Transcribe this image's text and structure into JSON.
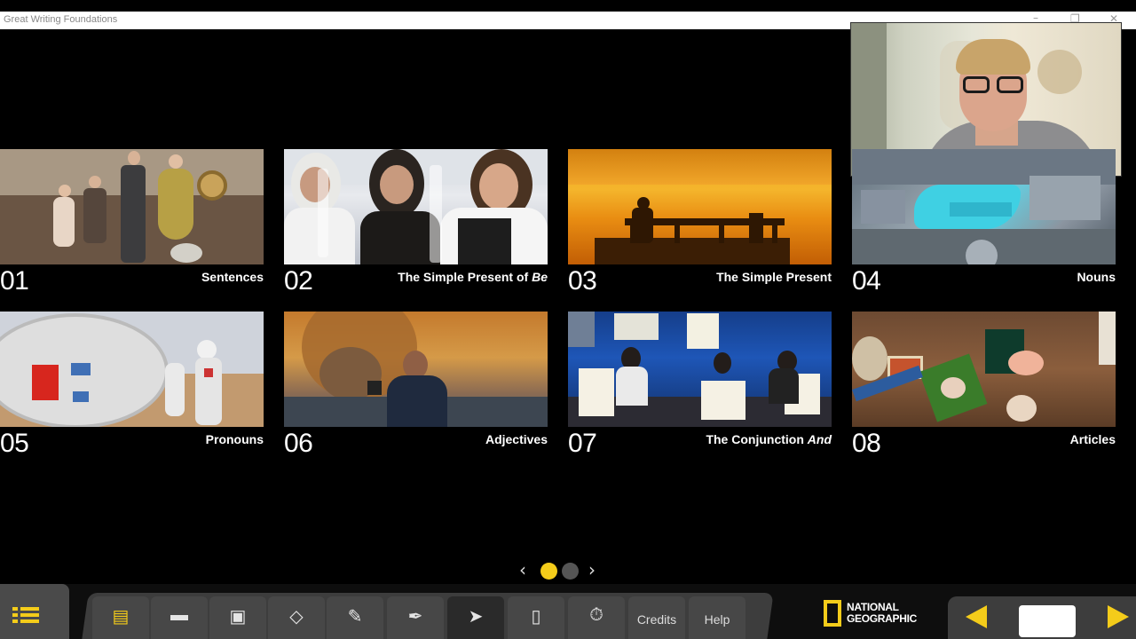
{
  "window": {
    "title": "Great Writing Foundations",
    "controls": {
      "minimize": "–",
      "maximize": "❐",
      "close": "✕"
    }
  },
  "cards": [
    {
      "number": "01",
      "label": "Sentences",
      "label_italic": ""
    },
    {
      "number": "02",
      "label": "The Simple Present of ",
      "label_italic": "Be"
    },
    {
      "number": "03",
      "label": "The Simple Present",
      "label_italic": ""
    },
    {
      "number": "04",
      "label": "Nouns",
      "label_italic": ""
    },
    {
      "number": "05",
      "label": "Pronouns",
      "label_italic": ""
    },
    {
      "number": "06",
      "label": "Adjectives",
      "label_italic": ""
    },
    {
      "number": "07",
      "label": "The Conjunction ",
      "label_italic": "And"
    },
    {
      "number": "08",
      "label": "Articles",
      "label_italic": ""
    }
  ],
  "pager": {
    "prev": "‹",
    "next": "›",
    "current_page": 1,
    "total_pages": 2
  },
  "toolbar": {
    "tools": [
      {
        "name": "gallery-icon",
        "glyph": "▤",
        "label": ""
      },
      {
        "name": "presentation-icon",
        "glyph": "▬",
        "label": ""
      },
      {
        "name": "blocks-icon",
        "glyph": "▣",
        "label": ""
      },
      {
        "name": "eraser-icon",
        "glyph": "◇",
        "label": ""
      },
      {
        "name": "pencil-icon",
        "glyph": "✎",
        "label": ""
      },
      {
        "name": "marker-icon",
        "glyph": "✒",
        "label": ""
      },
      {
        "name": "pointer-icon",
        "glyph": "➤",
        "label": ""
      },
      {
        "name": "page-icon",
        "glyph": "▯",
        "label": ""
      },
      {
        "name": "timer-icon",
        "glyph": "⏱",
        "label": ""
      }
    ],
    "credits_label": "Credits",
    "help_label": "Help",
    "brand_line1": "NATIONAL",
    "brand_line2": "GEOGRAPHIC",
    "accent_color": "#f4cc1a"
  }
}
